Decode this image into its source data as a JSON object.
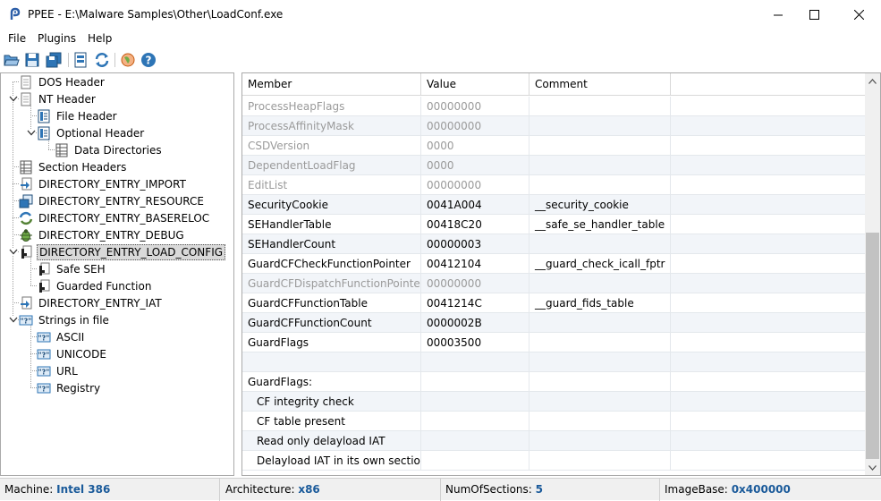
{
  "window": {
    "title": "PPEE - E:\\Malware Samples\\Other\\LoadConf.exe",
    "app_icon": "ppee-logo-icon"
  },
  "menu": {
    "items": [
      "File",
      "Plugins",
      "Help"
    ]
  },
  "toolbar": {
    "icons": [
      "open-folder-icon",
      "save-icon",
      "save-all-icon",
      "hex-view-icon",
      "refresh-icon",
      "web-lookup-icon",
      "help-icon"
    ]
  },
  "tree": {
    "nodes": [
      {
        "label": "DOS Header",
        "icon": "document-icon"
      },
      {
        "label": "NT Header",
        "icon": "document-icon",
        "expanded": true
      },
      {
        "label": "File Header",
        "icon": "table-icon"
      },
      {
        "label": "Optional Header",
        "icon": "table-icon",
        "expanded": true
      },
      {
        "label": "Data Directories",
        "icon": "grid-icon"
      },
      {
        "label": "Section Headers",
        "icon": "grid-icon"
      },
      {
        "label": "DIRECTORY_ENTRY_IMPORT",
        "icon": "import-icon"
      },
      {
        "label": "DIRECTORY_ENTRY_RESOURCE",
        "icon": "resource-icon"
      },
      {
        "label": "DIRECTORY_ENTRY_BASERELOC",
        "icon": "reloc-icon"
      },
      {
        "label": "DIRECTORY_ENTRY_DEBUG",
        "icon": "bug-icon"
      },
      {
        "label": "DIRECTORY_ENTRY_LOAD_CONFIG",
        "icon": "load-config-icon",
        "expanded": true,
        "selected": true
      },
      {
        "label": "Safe SEH",
        "icon": "load-config-icon"
      },
      {
        "label": "Guarded Function",
        "icon": "load-config-icon"
      },
      {
        "label": "DIRECTORY_ENTRY_IAT",
        "icon": "import-icon"
      },
      {
        "label": "Strings in file",
        "icon": "strings-icon",
        "expanded": true
      },
      {
        "label": "ASCII",
        "icon": "strings-icon"
      },
      {
        "label": "UNICODE",
        "icon": "strings-icon"
      },
      {
        "label": "URL",
        "icon": "strings-icon"
      },
      {
        "label": "Registry",
        "icon": "strings-icon"
      }
    ]
  },
  "grid": {
    "columns": [
      "Member",
      "Value",
      "Comment"
    ],
    "rows": [
      {
        "member": "ProcessHeapFlags",
        "value": "00000000",
        "comment": "",
        "dim": true
      },
      {
        "member": "ProcessAffinityMask",
        "value": "00000000",
        "comment": "",
        "dim": true
      },
      {
        "member": "CSDVersion",
        "value": "0000",
        "comment": "",
        "dim": true
      },
      {
        "member": "DependentLoadFlag",
        "value": "0000",
        "comment": "",
        "dim": true
      },
      {
        "member": "EditList",
        "value": "00000000",
        "comment": "",
        "dim": true
      },
      {
        "member": "SecurityCookie",
        "value": "0041A004",
        "comment": "__security_cookie",
        "dim": false
      },
      {
        "member": "SEHandlerTable",
        "value": "00418C20",
        "comment": "__safe_se_handler_table",
        "dim": false
      },
      {
        "member": "SEHandlerCount",
        "value": "00000003",
        "comment": "",
        "dim": false
      },
      {
        "member": "GuardCFCheckFunctionPointer",
        "value": "00412104",
        "comment": "__guard_check_icall_fptr",
        "dim": false
      },
      {
        "member": "GuardCFDispatchFunctionPointer",
        "value": "00000000",
        "comment": "",
        "dim": true
      },
      {
        "member": "GuardCFFunctionTable",
        "value": "0041214C",
        "comment": "__guard_fids_table",
        "dim": false
      },
      {
        "member": "GuardCFFunctionCount",
        "value": "0000002B",
        "comment": "",
        "dim": false
      },
      {
        "member": "GuardFlags",
        "value": "00003500",
        "comment": "",
        "dim": false
      },
      {
        "member": "",
        "value": "",
        "comment": "",
        "dim": false
      },
      {
        "member": "GuardFlags:",
        "value": "",
        "comment": "",
        "dim": false
      },
      {
        "member": "CF integrity check",
        "value": "",
        "comment": "",
        "dim": false,
        "indent": true
      },
      {
        "member": "CF table present",
        "value": "",
        "comment": "",
        "dim": false,
        "indent": true
      },
      {
        "member": "Read only delayload IAT",
        "value": "",
        "comment": "",
        "dim": false,
        "indent": true
      },
      {
        "member": "Delayload IAT in its own section",
        "value": "",
        "comment": "",
        "dim": false,
        "indent": true
      }
    ]
  },
  "status": {
    "machine_label": "Machine:",
    "machine_value": "Intel 386",
    "arch_label": "Architecture:",
    "arch_value": "x86",
    "sections_label": "NumOfSections:",
    "sections_value": "5",
    "imagebase_label": "ImageBase:",
    "imagebase_value": "0x400000"
  },
  "colors": {
    "accent": "#1a5a9a",
    "dim_text": "#9a9a9a",
    "alt_row": "#f2f5f9"
  }
}
